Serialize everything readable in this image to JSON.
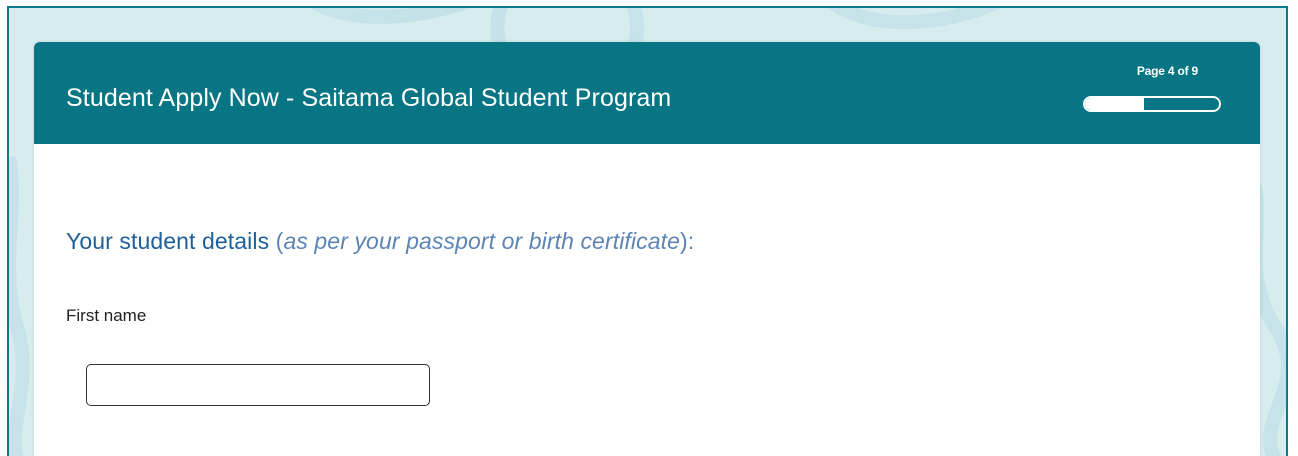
{
  "form": {
    "title": "Student Apply Now - Saitama Global Student Program",
    "page_indicator": "Page 4 of 9",
    "progress_fraction": 0.444
  },
  "section": {
    "heading": "Your student details",
    "paren_open": " (",
    "note": "as per your passport or birth certificate",
    "paren_close": "):"
  },
  "fields": {
    "first_name": {
      "label": "First name",
      "value": "",
      "placeholder": ""
    }
  },
  "colors": {
    "header": "#087584",
    "frame_border": "#0b7a8a",
    "background": "#d7ecef",
    "heading": "#1f5f99",
    "note": "#5c84b5"
  }
}
